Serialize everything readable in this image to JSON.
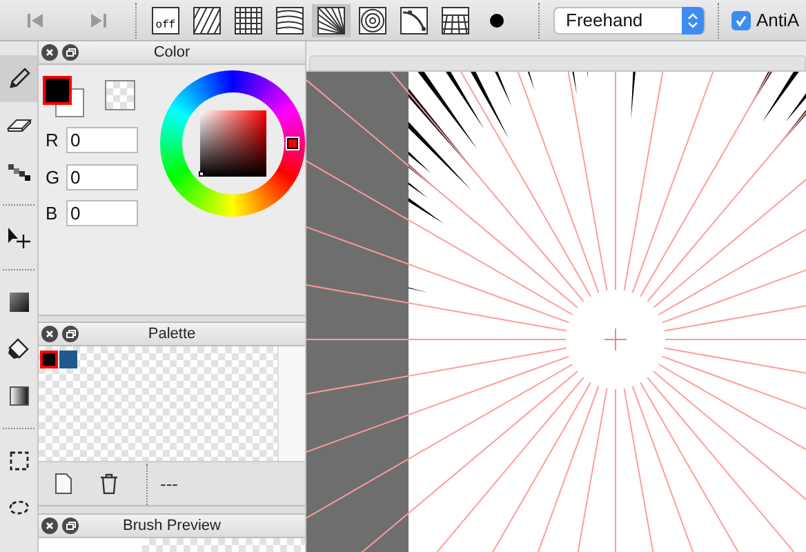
{
  "toolbar": {
    "ruler_modes": [
      {
        "kind": "off",
        "label": "off",
        "selected": false
      },
      {
        "kind": "parallel",
        "selected": false
      },
      {
        "kind": "grid",
        "selected": false
      },
      {
        "kind": "curve-parallel",
        "selected": false
      },
      {
        "kind": "radial",
        "selected": true
      },
      {
        "kind": "concentric",
        "selected": false
      },
      {
        "kind": "curve",
        "selected": false
      },
      {
        "kind": "perspective",
        "selected": false
      },
      {
        "kind": "dot",
        "selected": false
      }
    ],
    "ruler_select": {
      "value": "Freehand"
    },
    "antialias": {
      "label": "AntiA",
      "checked": true
    }
  },
  "tools": [
    {
      "kind": "pencil",
      "selected": true
    },
    {
      "kind": "eraser",
      "selected": false
    },
    {
      "kind": "dots",
      "selected": false
    },
    {
      "kind": "separator"
    },
    {
      "kind": "move",
      "selected": false
    },
    {
      "kind": "separator"
    },
    {
      "kind": "fill-square",
      "selected": false
    },
    {
      "kind": "bucket",
      "selected": false
    },
    {
      "kind": "gradient",
      "selected": false
    },
    {
      "kind": "separator"
    },
    {
      "kind": "select",
      "selected": false
    },
    {
      "kind": "lasso",
      "selected": false
    }
  ],
  "color_panel": {
    "title": "Color",
    "swatches": [
      {
        "kind": "foreground",
        "color": "#000000"
      },
      {
        "kind": "background",
        "color": "#ffffff"
      }
    ],
    "fields": [
      {
        "label": "R",
        "value": "0"
      },
      {
        "label": "G",
        "value": "0"
      },
      {
        "label": "B",
        "value": "0"
      }
    ]
  },
  "palette_panel": {
    "title": "Palette",
    "swatches": [
      {
        "color": "#000000",
        "selected": true
      },
      {
        "color": "#1f5a8c",
        "selected": false
      }
    ],
    "footer_text": "---"
  },
  "brush_preview_panel": {
    "title": "Brush Preview"
  }
}
